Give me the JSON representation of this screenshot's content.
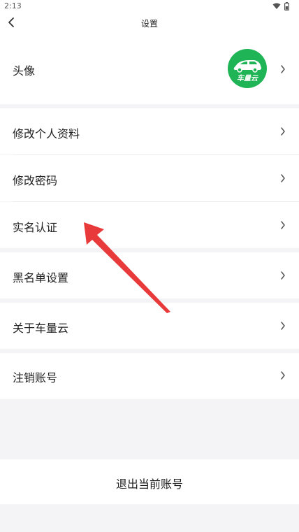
{
  "status_bar": {
    "time": "2:13"
  },
  "header": {
    "title": "设置"
  },
  "avatar_row": {
    "label": "头像",
    "avatar_text": "车量云"
  },
  "menu": {
    "edit_profile": "修改个人资料",
    "change_password": "修改密码",
    "real_name_auth": "实名认证",
    "blacklist_settings": "黑名单设置",
    "about": "关于车量云",
    "cancel_account": "注销账号"
  },
  "logout": {
    "label": "退出当前账号"
  },
  "colors": {
    "accent_green": "#1fb455",
    "annotation_arrow": "#e83a3a",
    "background": "#f4f4f6"
  },
  "icons": [
    "wifi-icon",
    "battery-icon",
    "back-arrow-icon",
    "chevron-right-icon",
    "car-logo-icon"
  ]
}
